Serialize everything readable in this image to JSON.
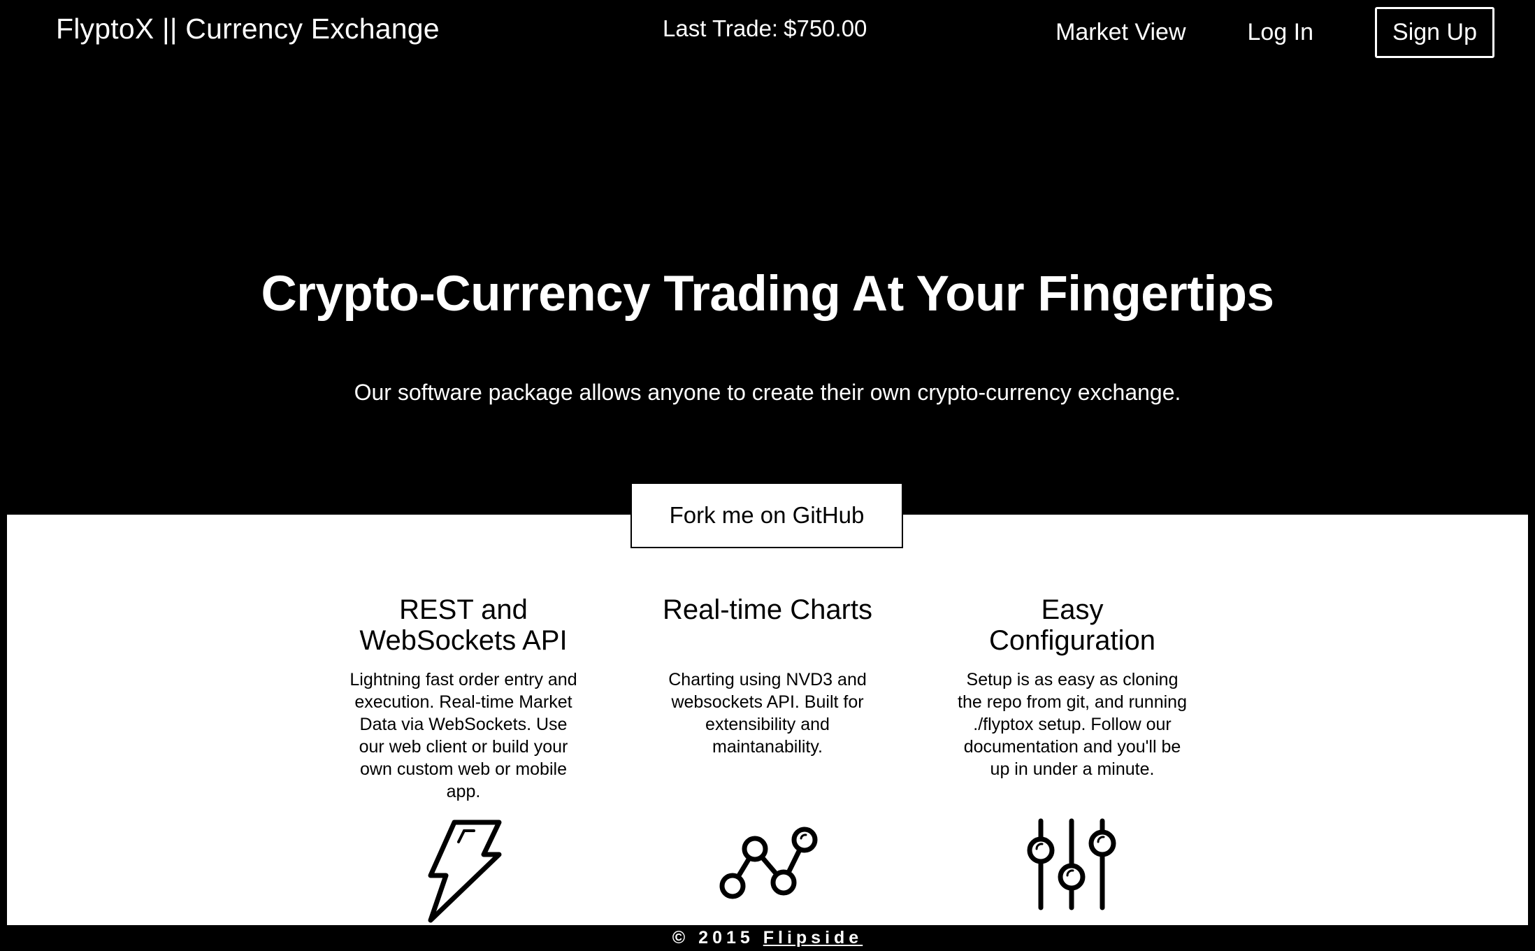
{
  "navbar": {
    "brand": "FlyptoX || Currency Exchange",
    "last_trade_label": "Last Trade:",
    "last_trade_value": "$750.00",
    "links": {
      "market_view": "Market View",
      "log_in": "Log In",
      "sign_up": "Sign Up"
    }
  },
  "hero": {
    "title": "Crypto-Currency Trading At Your Fingertips",
    "subtitle": "Our software package allows anyone to create their own crypto-currency exchange.",
    "cta_label": "Fork me on GitHub"
  },
  "features": [
    {
      "title": "REST and WebSockets API",
      "description": "Lightning fast order entry and execution. Real-time Market Data via WebSockets. Use our web client or build your own custom web or mobile app.",
      "icon": "lightning-bolt-icon"
    },
    {
      "title": "Real-time Charts",
      "description": "Charting using NVD3 and websockets API. Built for extensibility and maintanability.",
      "icon": "line-chart-icon"
    },
    {
      "title": "Easy Configuration",
      "description": "Setup is as easy as cloning the repo from git, and running ./flyptox setup. Follow our documentation and you'll be up in under a minute.",
      "icon": "sliders-icon"
    }
  ],
  "footer": {
    "copyright": "© 2015",
    "link_label": "Flipside"
  },
  "colors": {
    "background": "#000000",
    "panel": "#ffffff",
    "text_dark": "#000000",
    "text_light": "#ffffff"
  }
}
